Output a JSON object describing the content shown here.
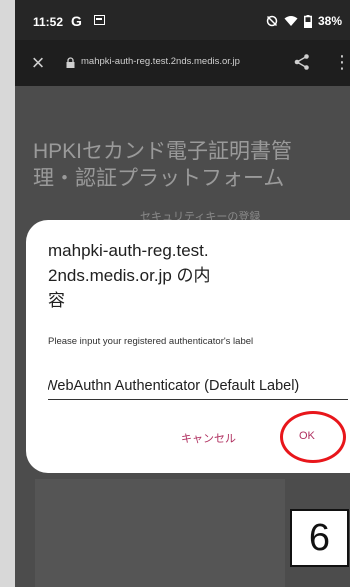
{
  "status_bar": {
    "time": "11:52",
    "g_label": "G",
    "battery": "38%"
  },
  "url_bar": {
    "url": "mahpki-auth-reg.test.2nds.medis.or.jp"
  },
  "page": {
    "title": "HPKIセカンド電子証明書管理・認証プラットフォーム",
    "subtitle": "セキュリティキーの登録"
  },
  "dialog": {
    "title": "mahpki-auth-reg.test.\n2nds.medis.or.jp の内\n容",
    "message": "Please input your registered authenticator's label",
    "input_value": "WebAuthn Authenticator (Default Label)",
    "cancel_label": "キャンセル",
    "ok_label": "OK"
  },
  "annotation": {
    "step_number": "6",
    "highlight_color": "#e8161b"
  },
  "colors": {
    "accent": "#b03060",
    "status_bar_bg": "#262626",
    "url_bar_bg": "#1e1e1e",
    "scrim": "#4c4c4c"
  },
  "icons": {
    "close": "close-icon",
    "lock": "lock-icon",
    "share": "share-icon",
    "more": "more-vert-icon",
    "dnd": "do-not-disturb-icon",
    "wifi": "wifi-icon",
    "battery": "battery-icon"
  }
}
